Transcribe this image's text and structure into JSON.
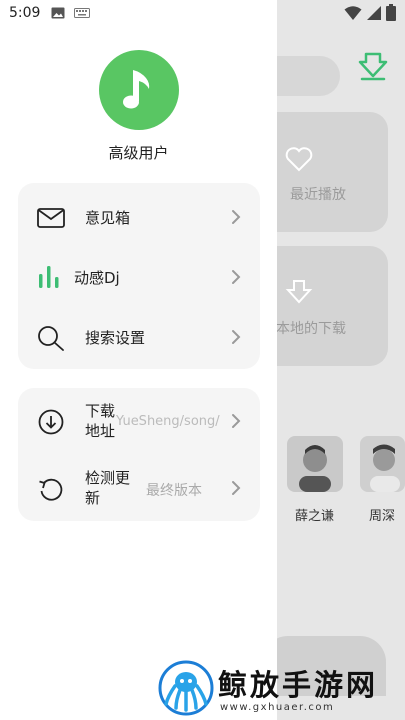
{
  "status_bar": {
    "time": "5:09"
  },
  "background": {
    "card1_label": "最近播放",
    "card2_label": "本地的下载",
    "artist1_name": "薛之谦",
    "artist2_name": "周深"
  },
  "drawer": {
    "username": "高级用户",
    "menu": {
      "feedback_label": "意见箱",
      "dj_label": "动感Dj",
      "search_settings_label": "搜索设置",
      "download_path_label": "下载\n地址",
      "download_path_value": "YueSheng/song/",
      "check_update_label": "检测更\n新",
      "check_update_value": "最终版本"
    }
  },
  "watermark": {
    "title": "鲸放手游网",
    "url": "www.gxhuaer.com"
  },
  "colors": {
    "accent_green": "#59c663",
    "dj_icon_green": "#3dbd74",
    "dim_overlay": "#e6e6e6"
  }
}
